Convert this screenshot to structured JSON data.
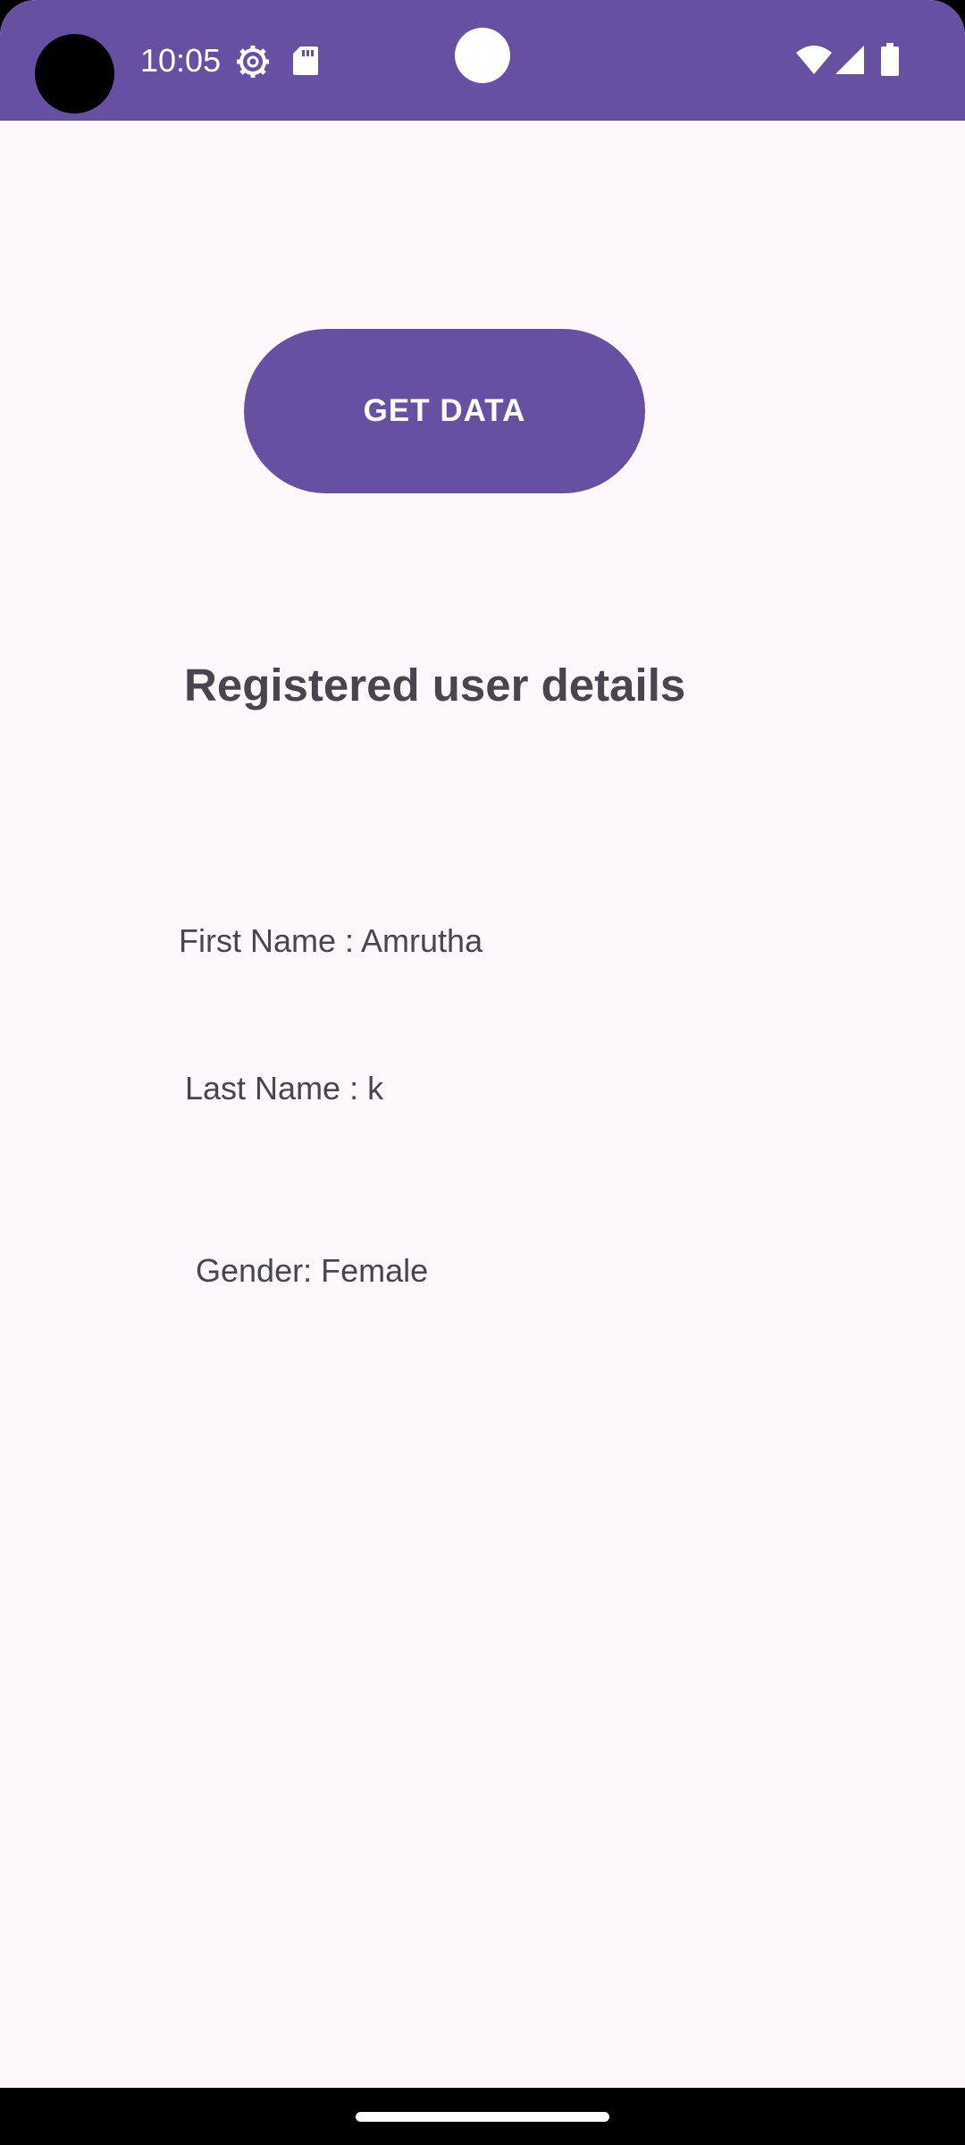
{
  "status_bar": {
    "time": "10:05",
    "background_color": "#6750a4",
    "icons": [
      "gear-icon",
      "sd-card-icon",
      "wifi-icon",
      "cell-signal-icon",
      "battery-icon"
    ]
  },
  "main": {
    "get_data_button_label": "GET DATA",
    "section_title": "Registered user details",
    "first_name_text": "First Name : Amrutha",
    "last_name_text": "Last Name : k",
    "gender_text": "Gender: Female"
  },
  "colors": {
    "primary": "#6750a4",
    "background": "#fef7fc",
    "text": "#49454f"
  }
}
